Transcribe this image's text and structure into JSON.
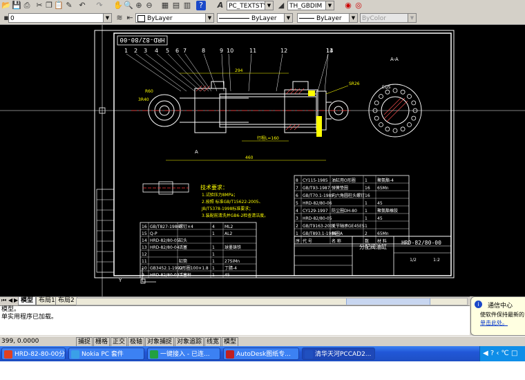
{
  "toolbar": {
    "text_style": "PC_TEXTSTYLE",
    "dim_style": "TH_GBDIM"
  },
  "layer_bar": {
    "layer": "0",
    "color": "ByLayer",
    "linetype": "ByLayer",
    "lineweight": "ByLayer",
    "plotstyle": "ByColor"
  },
  "drawing": {
    "title_box": "HRD-82/80-00",
    "balloons": [
      "1",
      "2",
      "3",
      "4",
      "5",
      "6",
      "7",
      "8",
      "9",
      "10",
      "11",
      "12",
      "13",
      "14"
    ],
    "section_label": "A-A",
    "section_note": "EQS",
    "tech_title": "技术要求：",
    "tech_lines": [
      "1.试验压力8MPa；",
      "2.按照 标准GB/T15622-2005、",
      "JB/T5378-1998标准要求；",
      "3.装配前清洗并GB6-2检查清洁度。"
    ],
    "parts_upper": [
      {
        "no": "8",
        "code": "CY115-1985",
        "name": "油缸用O形圈",
        "qty": "1",
        "mat": "聚氨酯-4"
      },
      {
        "no": "7",
        "code": "GB/T93-1987",
        "name": "弹簧垫圈",
        "qty": "16",
        "mat": "65Mn"
      },
      {
        "no": "6",
        "code": "GB/T70.1-1985",
        "name": "内六角圆柱头螺钉",
        "qty": "16",
        "mat": ""
      },
      {
        "no": "5",
        "code": "HRD-82/80-06",
        "name": "",
        "qty": "1",
        "mat": "45"
      },
      {
        "no": "4",
        "code": "CY129-1997",
        "name": "防尘圈DH-80",
        "qty": "1",
        "mat": "聚氨酯橡胶"
      },
      {
        "no": "3",
        "code": "HRD-82/80-05",
        "name": "",
        "qty": "1",
        "mat": "45"
      },
      {
        "no": "2",
        "code": "GB/T9163-2001",
        "name": "关节轴承GE45ES",
        "qty": "1",
        "mat": ""
      },
      {
        "no": "1",
        "code": "GB/T893.1-1986",
        "name": "挡圈A",
        "qty": "2",
        "mat": "65Mn"
      }
    ],
    "parts_header": [
      "序",
      "代 号",
      "名 称",
      "数",
      "材 料"
    ],
    "parts_lower": [
      {
        "no": "16",
        "code": "GB/T827-1986",
        "name": "螺钉×4",
        "qty": "4",
        "mat": "ML2"
      },
      {
        "no": "15",
        "code": "Q-P",
        "name": "",
        "qty": "1",
        "mat": "AL2"
      },
      {
        "no": "14",
        "code": "HRD-82/80-05",
        "name": "缸头",
        "qty": "",
        "mat": ""
      },
      {
        "no": "13",
        "code": "HRD-82/80-04",
        "name": "活塞",
        "qty": "1",
        "mat": "球墨铸铁"
      },
      {
        "no": "12",
        "code": "",
        "name": "",
        "qty": "1",
        "mat": ""
      },
      {
        "no": "11",
        "code": "",
        "name": "缸筒",
        "qty": "1",
        "mat": "27SiMn"
      },
      {
        "no": "10",
        "code": "GB3452.1-1992",
        "name": "O形圈100×1.8",
        "qty": "1",
        "mat": "丁腈-4"
      },
      {
        "no": "9",
        "code": "HRD-82/80-03",
        "name": "活塞杆",
        "qty": "1",
        "mat": "45"
      }
    ],
    "title_block_name": "分配阀油缸",
    "title_block_code": "HRD-82/80-00",
    "scale": "1:2",
    "sheet": "1/2"
  },
  "tabs": [
    "模型",
    "布局1",
    "布局2"
  ],
  "command_lines": [
    "模型。",
    "单实用程序已加载。"
  ],
  "coords": "399, 0.0000",
  "status_buttons": [
    "捕捉",
    "栅格",
    "正交",
    "极轴",
    "对象捕捉",
    "对象追踪",
    "线宽",
    "模型"
  ],
  "notification": {
    "title": "通信中心",
    "body": "使软件保持最新的",
    "link": "单击此处。"
  },
  "taskbar": {
    "items": [
      "HRD-82-80-00分...",
      "Nokia PC 套件",
      "一键接入 - 已连...",
      "AutoDesk图纸专...",
      "清华天河PCCAD2..."
    ],
    "active_index": 4,
    "tray": "◀ ? ‹ ℃ □"
  },
  "colors": {
    "canvas": "#000000",
    "lines": "#ffffff",
    "dims": "#ffff00",
    "center": "#ff3030",
    "title": "#00ffff",
    "accent": "#2157d7"
  }
}
